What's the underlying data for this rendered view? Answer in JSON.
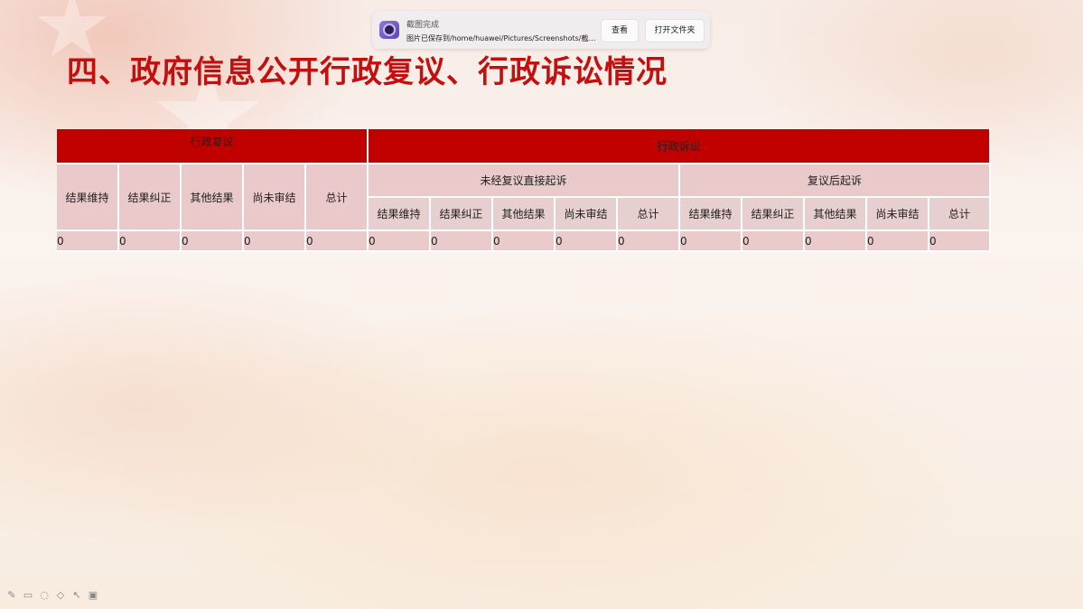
{
  "slide": {
    "title": "四、政府信息公开行政复议、行政诉讼情况"
  },
  "toast": {
    "title": "截图完成",
    "path": "图片已保存到/home/huawei/Pictures/Screenshots/截…",
    "view_label": "查看",
    "open_folder_label": "打开文件夹"
  },
  "table": {
    "group_admin_review": "行政复议",
    "group_admin_litigation": "行政诉讼",
    "sub_direct": "未经复议直接起诉",
    "sub_after_review": "复议后起诉",
    "review_headers": [
      "结果维持",
      "结果纠正",
      "其他结果",
      "尚未审结",
      "总计"
    ],
    "direct_headers": [
      "结果维持",
      "结果纠正",
      "其他结果",
      "尚未审结",
      "总计"
    ],
    "after_headers": [
      "结果维持",
      "结果纠正",
      "其他结果",
      "尚未审结",
      "总计"
    ],
    "values": [
      "0",
      "0",
      "0",
      "0",
      "0",
      "0",
      "0",
      "0",
      "0",
      "0",
      "0",
      "0",
      "0",
      "0",
      "0"
    ]
  },
  "colors": {
    "title_red": "#c40f0f",
    "header_red": "#c10000",
    "header_pink": "#e9c9c9",
    "cell_pink": "#eacaca"
  },
  "toolbar_icons": [
    "pen-icon",
    "screen-icon",
    "eraser-icon",
    "highlighter-icon",
    "pointer-icon",
    "camera-icon"
  ]
}
